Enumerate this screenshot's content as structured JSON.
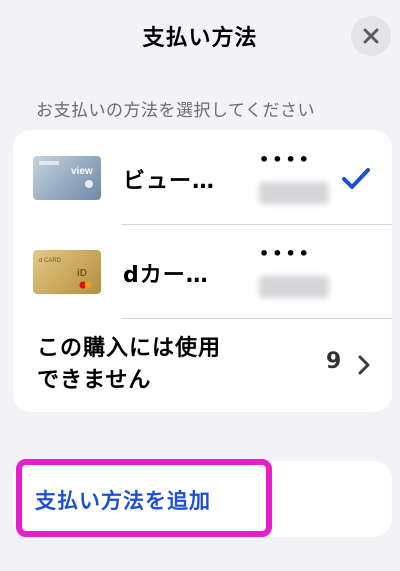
{
  "header": {
    "title": "支払い方法",
    "close_icon": "close-icon"
  },
  "section_label": "お支払いの方法を選択してください",
  "cards": [
    {
      "name": "ビュー…",
      "dots": "••••",
      "selected": true,
      "card_color": "#9fb3c8",
      "icon": "card-view-icon"
    },
    {
      "name": "dカー…",
      "dots": "••••",
      "selected": false,
      "card_color": "#c9a85c",
      "icon": "card-dcard-icon"
    }
  ],
  "unavailable": {
    "line1": "この購入には使用",
    "line2": "できません",
    "count": "9"
  },
  "add_method": {
    "label": "支払い方法を追加"
  },
  "colors": {
    "accent": "#1b4fd6",
    "highlight": "#e81ec8",
    "check": "#1b4fd6"
  }
}
